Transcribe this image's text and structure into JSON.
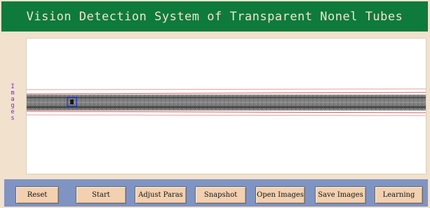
{
  "window": {
    "title": "Vision Detection System of Transparent Nonel Tubes"
  },
  "side_label": {
    "letters": [
      "I",
      "m",
      "a",
      "g",
      "e",
      "s"
    ]
  },
  "image_view": {
    "content": "nonel-tube-image",
    "detection_box_color": "#1a2bd9",
    "boundary_line_color": "#d26060"
  },
  "toolbar": {
    "buttons": [
      {
        "label": "Reset"
      },
      {
        "label": "Start"
      },
      {
        "label": "Adjust Paras"
      },
      {
        "label": "Snapshot"
      },
      {
        "label": "Open Images"
      },
      {
        "label": "Save Images"
      },
      {
        "label": "Learning"
      }
    ]
  },
  "colors": {
    "title_bar": "#0e7a3c",
    "title_text": "#f1e7c8",
    "background": "#f2e1cc",
    "toolbar": "#7f94c3",
    "button": "#f2d0b0",
    "side_label": "#7a1fd6"
  }
}
